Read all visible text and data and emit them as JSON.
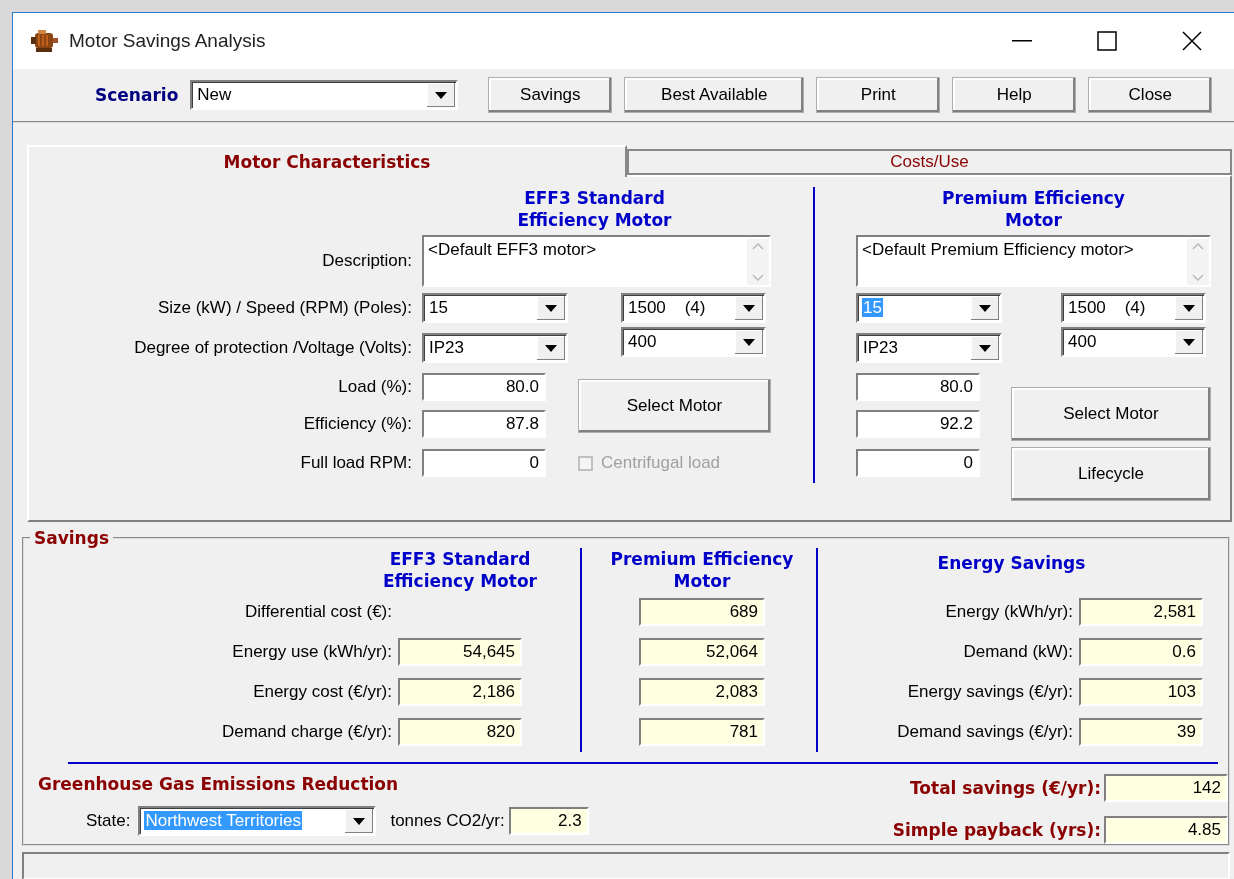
{
  "window": {
    "title": "Motor Savings Analysis"
  },
  "toolbar": {
    "scenario_label": "Scenario",
    "scenario": {
      "value": "New",
      "highlighted": false
    },
    "buttons": [
      "Savings",
      "Best Available",
      "Print",
      "Help",
      "Close"
    ]
  },
  "tabs": [
    {
      "label": "Motor Characteristics",
      "selected": true
    },
    {
      "label": "Costs/Use",
      "selected": false
    }
  ],
  "motor": {
    "labels": [
      "Description:",
      "Size (kW) / Speed (RPM) (Poles):",
      "Degree of protection /Voltage (Volts):",
      "Load (%):",
      "Efficiency (%):",
      "Full load RPM:"
    ],
    "columns": [
      {
        "heading": "EFF3 Standard\nEfficiency Motor",
        "description": "<Default EFF3 motor>",
        "size": {
          "value": "15",
          "highlighted": false
        },
        "speed": {
          "value": "1500    (4)",
          "highlighted": false
        },
        "protection": {
          "value": "IP23",
          "highlighted": false
        },
        "voltage": {
          "value": "400",
          "highlighted": false
        },
        "load": "80.0",
        "efficiency": "87.8",
        "full_load_rpm": "0",
        "buttons": [
          "Select Motor"
        ],
        "centrifugal_load": {
          "label": "Centrifugal load",
          "checked": false,
          "disabled": true
        }
      },
      {
        "heading": "Premium Efficiency\nMotor",
        "description": "<Default Premium Efficiency motor>",
        "size": {
          "value": "15",
          "highlighted": true
        },
        "speed": {
          "value": "1500    (4)",
          "highlighted": false
        },
        "protection": {
          "value": "IP23",
          "highlighted": false
        },
        "voltage": {
          "value": "400",
          "highlighted": false
        },
        "load": "80.0",
        "efficiency": "92.2",
        "full_load_rpm": "0",
        "buttons": [
          "Select Motor",
          "Lifecycle"
        ]
      }
    ]
  },
  "savings": {
    "title": "Savings",
    "standard_heading": "EFF3 Standard\nEfficiency Motor",
    "premium_heading": "Premium Efficiency\nMotor",
    "rows": [
      {
        "label": "Differential cost (€):",
        "premium": "689"
      },
      {
        "label": "Energy use (kWh/yr):",
        "standard": "54,645",
        "premium": "52,064"
      },
      {
        "label": "Energy cost (€/yr):",
        "standard": "2,186",
        "premium": "2,083"
      },
      {
        "label": "Demand charge (€/yr):",
        "standard": "820",
        "premium": "781"
      }
    ],
    "energy_savings": {
      "heading": "Energy Savings",
      "rows": [
        {
          "label": "Energy (kWh/yr):",
          "value": "2,581"
        },
        {
          "label": "Demand (kW):",
          "value": "0.6"
        },
        {
          "label": "Energy savings (€/yr):",
          "value": "103"
        },
        {
          "label": "Demand savings (€/yr):",
          "value": "39"
        }
      ]
    },
    "ghg": {
      "heading": "Greenhouse Gas Emissions Reduction",
      "state_label": "State:",
      "state": {
        "value": "Northwest Territories",
        "highlighted": true
      },
      "tonnes_label": "tonnes CO2/yr:",
      "tonnes": "2.3"
    },
    "totals": [
      {
        "label": "Total savings (€/yr):",
        "value": "142"
      },
      {
        "label": "Simple payback (yrs):",
        "value": "4.85"
      }
    ]
  }
}
